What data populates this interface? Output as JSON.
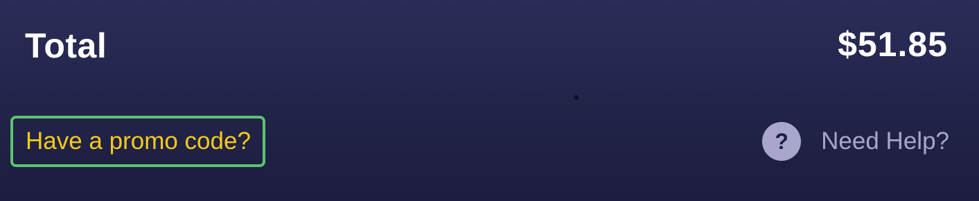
{
  "total": {
    "label": "Total",
    "amount": "$51.85"
  },
  "promo": {
    "label": "Have a promo code?"
  },
  "help": {
    "icon": "question-circle-icon",
    "icon_glyph": "?",
    "label": "Need Help?"
  },
  "colors": {
    "background": "#22244a",
    "text_primary": "#ffffff",
    "promo_text": "#f5cb18",
    "promo_outline": "#5cc36e",
    "help": "#a8a6cc"
  }
}
